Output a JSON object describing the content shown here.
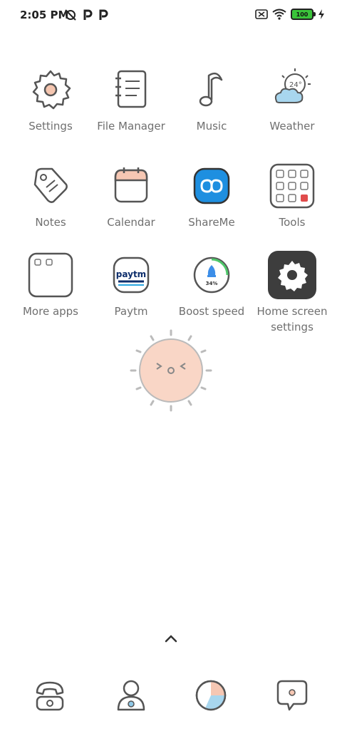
{
  "status_bar": {
    "time": "2:05 PM",
    "battery": "100"
  },
  "apps": [
    {
      "label": "Settings",
      "icon": "gear-icon"
    },
    {
      "label": "File Manager",
      "icon": "notebook-icon"
    },
    {
      "label": "Music",
      "icon": "music-note-icon"
    },
    {
      "label": "Weather",
      "icon": "weather-icon",
      "temp": "24°"
    },
    {
      "label": "Notes",
      "icon": "tag-icon"
    },
    {
      "label": "Calendar",
      "icon": "calendar-icon"
    },
    {
      "label": "ShareMe",
      "icon": "infinity-icon"
    },
    {
      "label": "Tools",
      "icon": "folder-icon"
    },
    {
      "label": "More apps",
      "icon": "folder-icon"
    },
    {
      "label": "Paytm",
      "icon": "paytm-icon",
      "brand_text": "paytm"
    },
    {
      "label": "Boost speed",
      "icon": "rocket-icon",
      "percent": "34%"
    },
    {
      "label": "Home screen settings",
      "icon": "gear-icon"
    }
  ],
  "dock": [
    {
      "icon": "phone-icon"
    },
    {
      "icon": "contacts-icon"
    },
    {
      "icon": "browser-icon"
    },
    {
      "icon": "message-icon"
    }
  ],
  "colors": {
    "label": "#6f6f6f",
    "shareme_blue": "#1e8fe0",
    "settings_dark": "#3d3d3d",
    "paytm_blue": "#0d2d6b",
    "battery_green": "#3ac43a"
  }
}
